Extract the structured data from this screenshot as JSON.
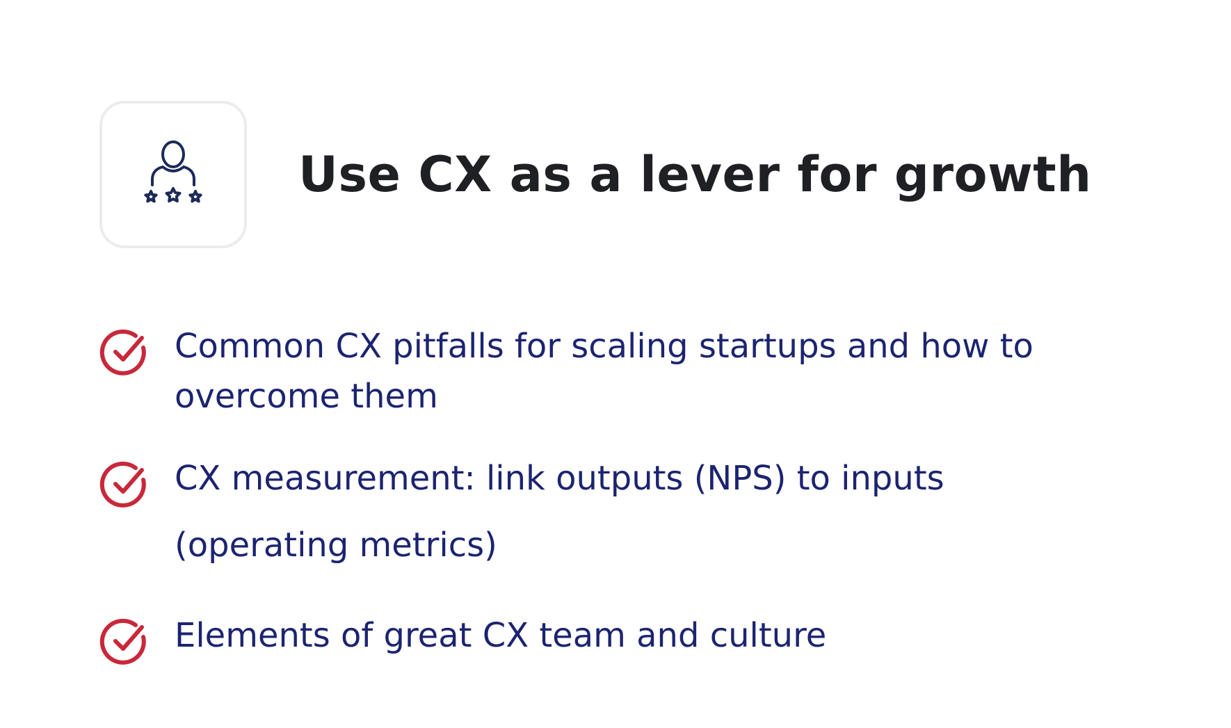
{
  "header": {
    "icon": "customer-rating-icon",
    "title": "Use CX as a lever for growth"
  },
  "list": {
    "items": [
      {
        "icon": "check-circle-icon",
        "text": "Common CX pitfalls for scaling startups and how to overcome them"
      },
      {
        "icon": "check-circle-icon",
        "text": "CX measurement: link outputs (NPS) to inputs (operating metrics)"
      },
      {
        "icon": "check-circle-icon",
        "text": "Elements of great CX team and culture"
      }
    ]
  },
  "colors": {
    "title": "#1f2024",
    "item_text": "#1c2470",
    "icon_navy": "#1c2a5a",
    "check_red": "#c8283a",
    "tile_border": "#ececee"
  }
}
